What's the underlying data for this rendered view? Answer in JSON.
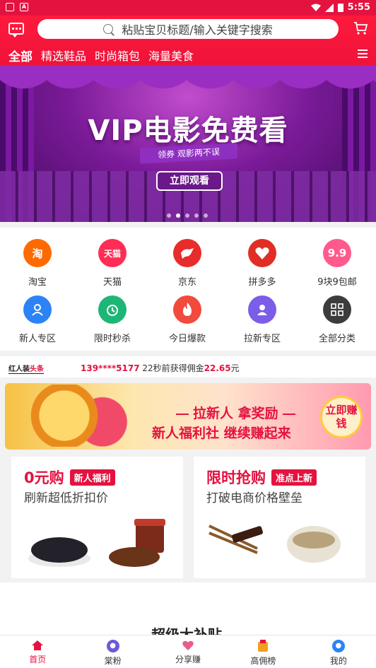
{
  "status_bar": {
    "time": "5:55"
  },
  "header": {
    "search_placeholder": "粘贴宝贝标题/输入关键字搜索",
    "tabs": [
      "全部",
      "精选鞋品",
      "时尚箱包",
      "海量美食"
    ],
    "active_tab": "全部"
  },
  "banner": {
    "title": "VIP电影免费看",
    "ribbon": "领券 观影两不误",
    "button": "立即观看",
    "dots": 5,
    "active_dot": 1
  },
  "categories": [
    {
      "label": "淘宝",
      "icon_text": "淘",
      "icon": "taobao-icon",
      "color": "#ff6a00"
    },
    {
      "label": "天猫",
      "icon_text": "天猫",
      "icon": "tmall-icon",
      "color": "#ff2d55"
    },
    {
      "label": "京东",
      "icon_text": "",
      "icon": "jd-dog-icon",
      "color": "#e82c2c"
    },
    {
      "label": "拼多多",
      "icon_text": "",
      "icon": "pinduoduo-icon",
      "color": "#e02e24"
    },
    {
      "label": "9块9包邮",
      "icon_text": "9.9",
      "icon": "nine-nine-icon",
      "color": "#ff5a8c"
    },
    {
      "label": "新人专区",
      "icon_text": "",
      "icon": "new-user-icon",
      "color": "#2b83f6"
    },
    {
      "label": "限时秒杀",
      "icon_text": "",
      "icon": "alarm-clock-icon",
      "color": "#1eb676"
    },
    {
      "label": "今日爆款",
      "icon_text": "",
      "icon": "flame-icon",
      "color": "#f24a3c"
    },
    {
      "label": "拉新专区",
      "icon_text": "",
      "icon": "invite-user-icon",
      "color": "#7b5de8"
    },
    {
      "label": "全部分类",
      "icon_text": "",
      "icon": "grid-icon",
      "color": "#3c3c3c"
    }
  ],
  "headline": {
    "logo_left": "红人装",
    "logo_right": "头条",
    "phone": "139****5177",
    "text": " 22秒前获得佣金",
    "amount": "22.65",
    "unit": "元"
  },
  "promo": {
    "line1": "拉新人 拿奖励",
    "line2": "新人福利社 继续赚起来",
    "button": "立即赚钱"
  },
  "cards": [
    {
      "title": "0元购",
      "tag": "新人福利",
      "subtitle": "刷新超低折扣价"
    },
    {
      "title": "限时抢购",
      "tag": "准点上新",
      "subtitle": "打破电商价格壁垒"
    }
  ],
  "section_title": "超级大补贴",
  "bottom_nav": [
    {
      "label": "首页",
      "icon": "home-icon",
      "active": true
    },
    {
      "label": "棠粉",
      "icon": "fans-icon",
      "active": false
    },
    {
      "label": "分享赚",
      "icon": "share-heart-icon",
      "active": false
    },
    {
      "label": "高佣榜",
      "icon": "ranking-icon",
      "active": false
    },
    {
      "label": "我的",
      "icon": "profile-icon",
      "active": false
    }
  ]
}
